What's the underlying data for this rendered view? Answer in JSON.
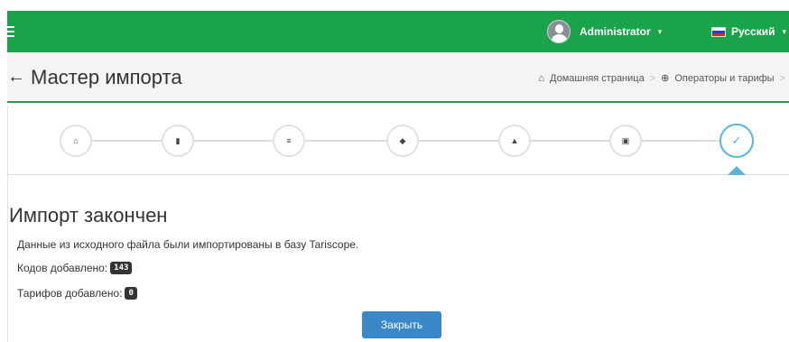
{
  "topbar": {
    "user_name": "Administrator",
    "user_caret": "▾",
    "language": "Русский",
    "lang_caret": "▾",
    "bg_color": "#1aa34a"
  },
  "header": {
    "back_arrow": "←",
    "title": "Мастер импорта",
    "breadcrumb": {
      "home_icon": "⌂",
      "home": "Домашняя страница",
      "sep1": ">",
      "globe_icon": "⊕",
      "operators": "Операторы и тарифы",
      "sep2": ">"
    }
  },
  "wizard": {
    "steps": [
      {
        "icon": "home-icon",
        "glyph": "⌂"
      },
      {
        "icon": "file-icon",
        "glyph": "▮"
      },
      {
        "icon": "list-icon",
        "glyph": "≡"
      },
      {
        "icon": "tag-icon",
        "glyph": "◆"
      },
      {
        "icon": "lock-icon",
        "glyph": "▲"
      },
      {
        "icon": "box-icon",
        "glyph": "▣"
      },
      {
        "icon": "check-icon",
        "glyph": "✓",
        "active": true
      }
    ],
    "active_color": "#5bb3d9"
  },
  "result": {
    "title": "Импорт закончен",
    "description": "Данные из исходного файла были импортированы в базу Tariscope.",
    "codes_label": "Кодов добавлено:",
    "codes_value": "143",
    "tariffs_label": "Тарифов добавлено:",
    "tariffs_value": "0",
    "close_button": "Закрыть"
  }
}
